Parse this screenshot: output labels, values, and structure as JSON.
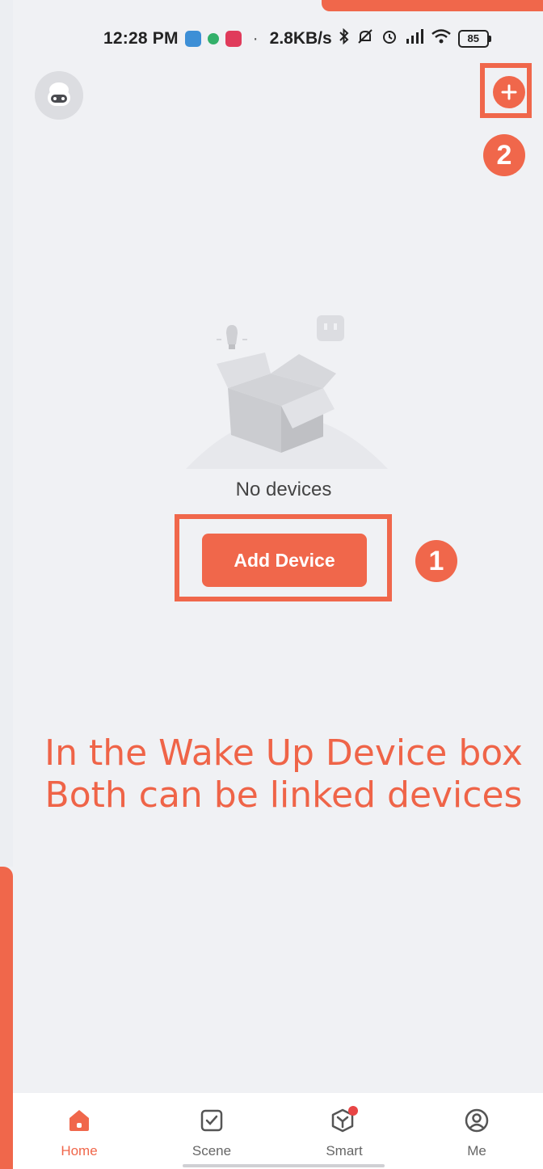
{
  "colors": {
    "accent": "#f0674b",
    "background": "#f0f1f4",
    "caption": "#ef6448"
  },
  "status_bar": {
    "time": "12:28 PM",
    "separator": "·",
    "net_speed": "2.8KB/s",
    "battery": "85",
    "icons": [
      "bluetooth-icon",
      "mute-icon",
      "alarm-icon",
      "signal-icon",
      "wifi-icon",
      "battery-icon"
    ]
  },
  "header": {
    "avatar_icon": "robot-avatar-icon",
    "add_icon": "plus-circle-icon"
  },
  "empty_state": {
    "illustration_icon": "empty-box-icon",
    "message": "No devices",
    "button_label": "Add Device"
  },
  "annotations": {
    "badge_1": "1",
    "badge_2": "2",
    "caption_line_1": "In the Wake Up Device box",
    "caption_line_2": "Both can be linked devices"
  },
  "bottom_nav": {
    "items": [
      {
        "label": "Home",
        "icon": "home-icon",
        "active": true
      },
      {
        "label": "Scene",
        "icon": "scene-checkbox-icon",
        "active": false
      },
      {
        "label": "Smart",
        "icon": "smart-cube-icon",
        "active": false
      },
      {
        "label": "Me",
        "icon": "profile-icon",
        "active": false
      }
    ]
  }
}
